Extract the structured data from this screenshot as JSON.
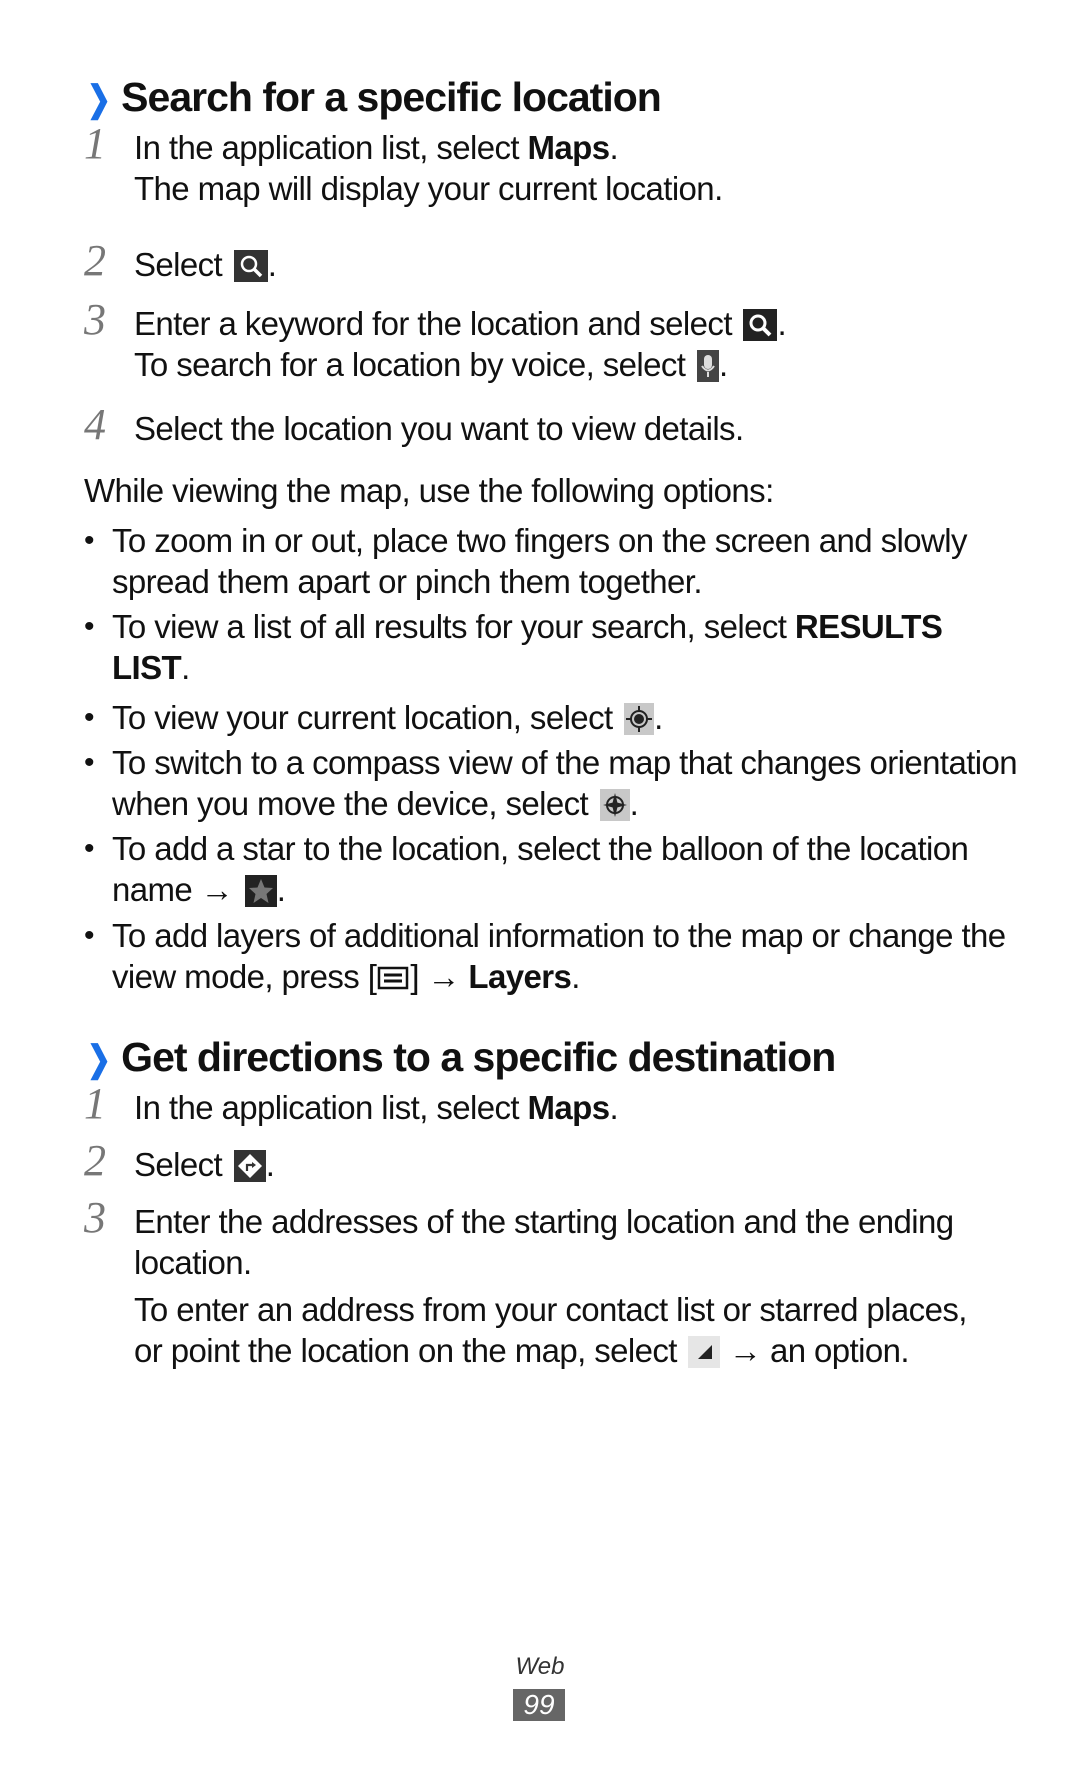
{
  "section1": {
    "title": "Search for a specific location",
    "steps": [
      {
        "num": "1",
        "text": "In the application list, select ",
        "bold": "Maps",
        "end": ".",
        "sub": "The map will display your current location."
      },
      {
        "num": "2",
        "text": "Select ",
        "icon": "search-icon",
        "end": "."
      },
      {
        "num": "3",
        "text": "Enter a keyword for the location and select ",
        "icon": "search-icon",
        "end": ".",
        "sub": "To search for a location by voice, select ",
        "sub_icon": "microphone-icon",
        "sub_end": "."
      },
      {
        "num": "4",
        "text": "Select the location you want to view details."
      }
    ],
    "intro": "While viewing the map, use the following options:",
    "bullets": [
      {
        "text": "To zoom in or out, place two fingers on the screen and slowly spread them apart or pinch them together."
      },
      {
        "text": "To view a list of all results for your search, select ",
        "bold": "RESULTS LIST",
        "end": "."
      },
      {
        "text": "To view your current location, select ",
        "icon": "my-location-icon",
        "end": "."
      },
      {
        "text": "To switch to a compass view of the map that changes orientation when you move the device, select ",
        "icon": "compass-icon",
        "end": "."
      },
      {
        "text": "To add a star to the location, select the balloon of the location name → ",
        "icon": "star-icon",
        "end": "."
      },
      {
        "text": "To add layers of additional information to the map or change the view mode, press [",
        "icon": "menu-key-icon",
        "mid": "] → ",
        "bold": "Layers",
        "end": "."
      }
    ]
  },
  "section2": {
    "title": "Get directions to a specific destination",
    "steps": [
      {
        "num": "1",
        "text": "In the application list, select ",
        "bold": "Maps",
        "end": "."
      },
      {
        "num": "2",
        "text": "Select ",
        "icon": "directions-icon",
        "end": "."
      },
      {
        "num": "3",
        "text": "Enter the addresses of the starting location and the ending location.",
        "sub": "To enter an address from your contact list or starred places, or point the location on the map, select ",
        "sub_icon": "dropdown-triangle-icon",
        "sub_end": " → an option."
      }
    ]
  },
  "footer": {
    "section_label": "Web",
    "page_number": "99"
  },
  "colors": {
    "accent": "#1a6fe6",
    "step_number": "#777777",
    "page_badge": "#666666"
  }
}
